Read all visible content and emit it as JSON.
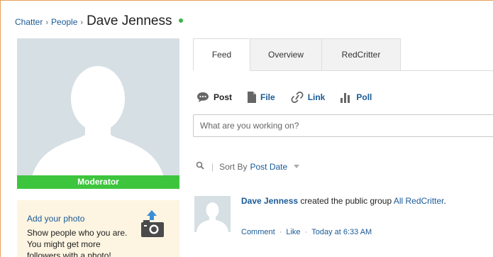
{
  "breadcrumb": {
    "items": [
      "Chatter",
      "People"
    ],
    "separator": "›",
    "current": "Dave Jenness"
  },
  "status": {
    "color": "#3cb44b",
    "label": ""
  },
  "profile": {
    "role_badge": "Moderator",
    "add_photo": {
      "title": "Add your photo",
      "text": "Show people who you are. You might get more followers with a photo!"
    }
  },
  "tabs": [
    {
      "label": "Feed",
      "active": true
    },
    {
      "label": "Overview",
      "active": false
    },
    {
      "label": "RedCritter",
      "active": false
    }
  ],
  "publisher": {
    "actions": [
      {
        "label": "Post",
        "icon": "speech-bubble-icon"
      },
      {
        "label": "File",
        "icon": "document-icon"
      },
      {
        "label": "Link",
        "icon": "link-icon"
      },
      {
        "label": "Poll",
        "icon": "bar-chart-icon"
      }
    ],
    "placeholder": "What are you working on?"
  },
  "sort": {
    "label": "Sort By",
    "value": "Post Date"
  },
  "feed": [
    {
      "author": "Dave Jenness",
      "verb": " created the public group ",
      "group": "All RedCritter",
      "end": ".",
      "actions": [
        "Comment",
        "Like"
      ],
      "time": "Today at 6:33 AM"
    }
  ],
  "colors": {
    "link": "#1a5a96",
    "accent_border": "#e8a15a",
    "moderator_badge": "#3dc53d",
    "photo_bg": "#d6dfe4",
    "add_photo_bg": "#fdf5e1"
  }
}
